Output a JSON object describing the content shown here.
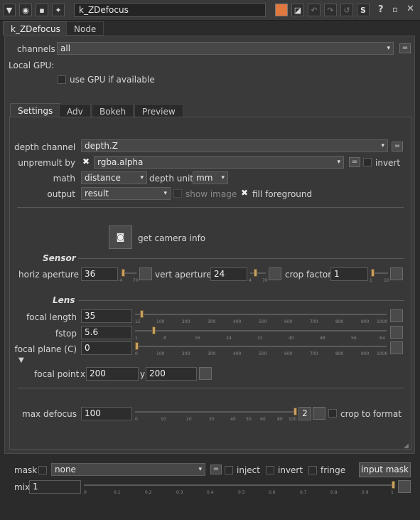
{
  "titlebar": {
    "node_name": "k_ZDefocus",
    "s_label": "S",
    "help_label": "?"
  },
  "top_tabs": [
    {
      "label": "k_ZDefocus"
    },
    {
      "label": "Node"
    }
  ],
  "channels": {
    "label": "channels",
    "value": "all"
  },
  "local_gpu": {
    "label": "Local GPU:",
    "use_gpu_label": "use GPU if available"
  },
  "inner_tabs": [
    {
      "label": "Settings"
    },
    {
      "label": "Adv"
    },
    {
      "label": "Bokeh"
    },
    {
      "label": "Preview"
    }
  ],
  "depth_channel": {
    "label": "depth channel",
    "value": "depth.Z"
  },
  "unpremult": {
    "label": "unpremult by",
    "value": "rgba.alpha",
    "invert_label": "invert"
  },
  "math": {
    "label": "math",
    "value": "distance",
    "depth_unit_label": "depth unit",
    "depth_unit_value": "mm"
  },
  "output": {
    "label": "output",
    "value": "result",
    "show_image_label": "show image",
    "fill_foreground_label": "fill foreground"
  },
  "camera": {
    "label": "get camera info"
  },
  "sensor": {
    "title": "Sensor",
    "horiz_label": "horiz aperture",
    "horiz_value": "36",
    "vert_label": "vert aperture",
    "vert_value": "24",
    "crop_label": "crop factor",
    "crop_value": "1",
    "mini_ticks": [
      "4",
      "70"
    ],
    "crop_ticks": [
      "1",
      "10"
    ]
  },
  "lens": {
    "title": "Lens",
    "focal_length_label": "focal length",
    "focal_length_value": "35",
    "focal_length_ticks": [
      "15",
      "100",
      "200",
      "300",
      "400",
      "500",
      "600",
      "700",
      "800",
      "900",
      "1000"
    ],
    "fstop_label": "fstop",
    "fstop_value": "5.6",
    "fstop_ticks": [
      "1",
      "8",
      "16",
      "24",
      "32",
      "40",
      "48",
      "56",
      "64"
    ],
    "focal_plane_label": "focal plane (C)",
    "focal_plane_value": "0",
    "focal_plane_ticks": [
      "0",
      "100",
      "200",
      "300",
      "400",
      "500",
      "600",
      "700",
      "800",
      "900",
      "1000"
    ],
    "focal_point_label": "focal point",
    "x_label": "x",
    "x_value": "200",
    "y_label": "y",
    "y_value": "200"
  },
  "max_defocus": {
    "label": "max defocus",
    "value": "100",
    "ticks": [
      "0",
      "10",
      "20",
      "30",
      "40",
      "50",
      "60",
      "80",
      "100"
    ],
    "button_value": "2",
    "crop_to_format_label": "crop to format"
  },
  "mask": {
    "label": "mask",
    "value": "none",
    "inject_label": "inject",
    "invert_label": "invert",
    "fringe_label": "fringe",
    "input_mask_label": "input mask"
  },
  "mix": {
    "label": "mix",
    "value": "1",
    "ticks": [
      "0",
      "0.1",
      "0.2",
      "0.3",
      "0.4",
      "0.5",
      "0.6",
      "0.7",
      "0.8",
      "0.9",
      "1"
    ]
  },
  "slider_levels": {
    "horiz_aperture": 0.05,
    "vert_aperture": 0.3,
    "crop_factor": 0.0,
    "focal_length": 0.02,
    "fstop": 0.07,
    "focal_plane": 0.0,
    "max_defocus": 1.0,
    "mix": 1.0
  }
}
